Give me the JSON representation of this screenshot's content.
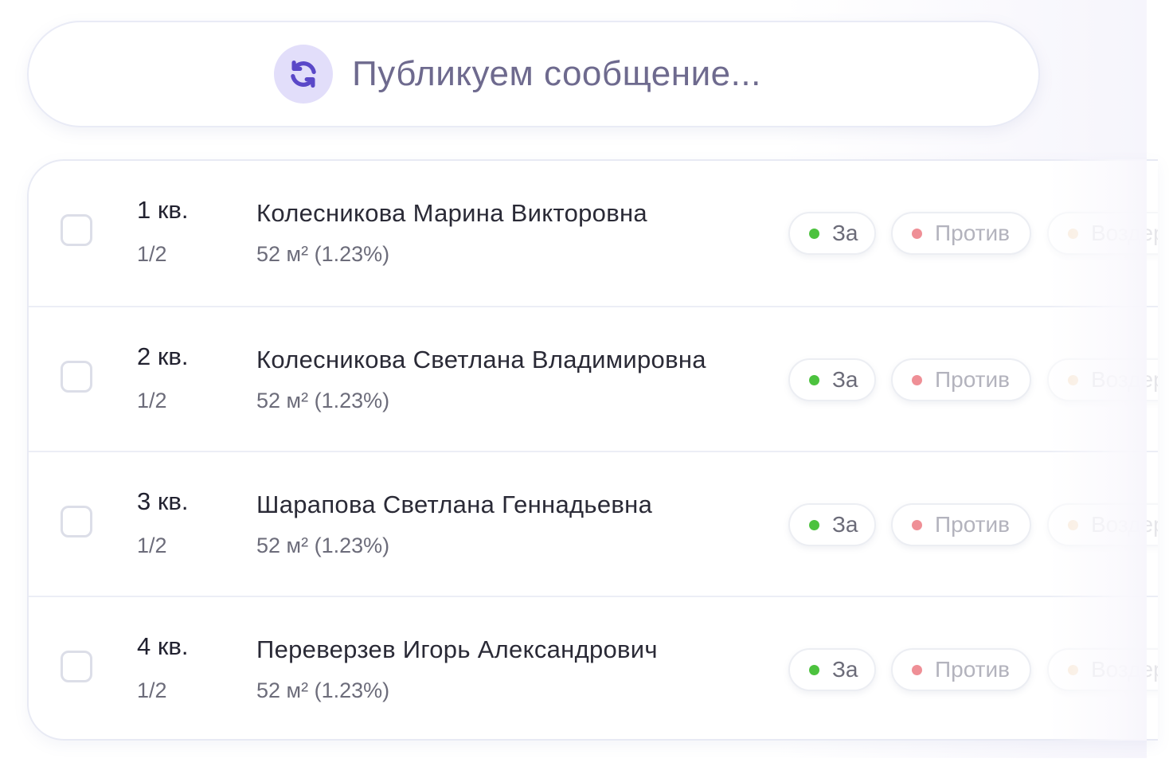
{
  "banner": {
    "icon": "sync-icon",
    "text": "Публикуем сообщение..."
  },
  "votes": {
    "for_label": "За",
    "against_label": "Против",
    "abstain_label": "Воздержался",
    "colors": {
      "for": "#4cc23e",
      "against": "#ef8f96",
      "abstain": "#f4d9b6"
    }
  },
  "rows": [
    {
      "apartment": "1 кв.",
      "share": "1/2",
      "owner": "Колесникова Марина Викторовна",
      "area": "52 м² (1.23%)"
    },
    {
      "apartment": "2 кв.",
      "share": "1/2",
      "owner": "Колесникова Светлана Владимировна",
      "area": "52 м² (1.23%)"
    },
    {
      "apartment": "3 кв.",
      "share": "1/2",
      "owner": "Шарапова Светлана Геннадьевна",
      "area": "52 м² (1.23%)"
    },
    {
      "apartment": "4 кв.",
      "share": "1/2",
      "owner": "Переверзев Игорь Александрович",
      "area": "52 м² (1.23%)"
    }
  ]
}
